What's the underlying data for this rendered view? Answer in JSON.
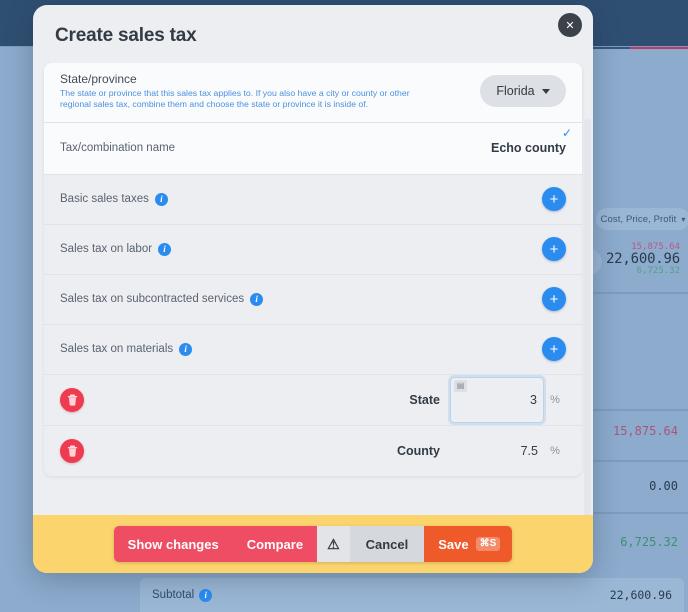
{
  "modal": {
    "title": "Create sales tax",
    "close_icon": "close-icon",
    "state_province": {
      "label": "State/province",
      "description": "The state or province that this sales tax applies to. If you also have a city or county or other regional sales tax, combine them and choose the state or province it is inside of.",
      "dropdown_value": "Florida"
    },
    "tax_name": {
      "label": "Tax/combination name",
      "value": "Echo county",
      "check_icon": "check-icon"
    },
    "sections": [
      {
        "label": "Basic sales taxes",
        "info_icon": "info-icon",
        "add_icon": "plus-icon"
      },
      {
        "label": "Sales tax on labor",
        "info_icon": "info-icon",
        "add_icon": "plus-icon"
      },
      {
        "label": "Sales tax on subcontracted services",
        "info_icon": "info-icon",
        "add_icon": "plus-icon"
      },
      {
        "label": "Sales tax on materials",
        "info_icon": "info-icon",
        "add_icon": "plus-icon"
      }
    ],
    "rates": [
      {
        "name": "State",
        "value": "3",
        "unit": "%",
        "focused": true,
        "delete_icon": "trash-icon",
        "calculator_icon": "calculator-icon"
      },
      {
        "name": "County",
        "value": "7.5",
        "unit": "%",
        "focused": false,
        "delete_icon": "trash-icon"
      }
    ],
    "footer": {
      "show_changes_label": "Show changes",
      "compare_label": "Compare",
      "warning_icon": "warning-triangle-icon",
      "cancel_label": "Cancel",
      "save_label": "Save",
      "save_shortcut": "⌘S"
    }
  },
  "background": {
    "view_pill": "Cost, Price, Profit",
    "summary": {
      "cost": "15,875.64",
      "price": "22,600.96",
      "profit": "6,725.32"
    },
    "rows": [
      {
        "value": "15,875.64",
        "color": "#a8567a"
      },
      {
        "value": "0.00",
        "color": "#2a3b4f"
      },
      {
        "value": "6,725.32",
        "color": "#3f8f72"
      }
    ],
    "subtotal": {
      "label": "Subtotal",
      "info_icon": "info-icon",
      "value": "22,600.96"
    }
  },
  "colors": {
    "accent_blue": "#2b8cf0",
    "danger_red": "#ef3b4f",
    "footer_yellow": "#fbd46d",
    "save_orange": "#ef5a2b",
    "topbar_navy": "#2f4f72"
  }
}
